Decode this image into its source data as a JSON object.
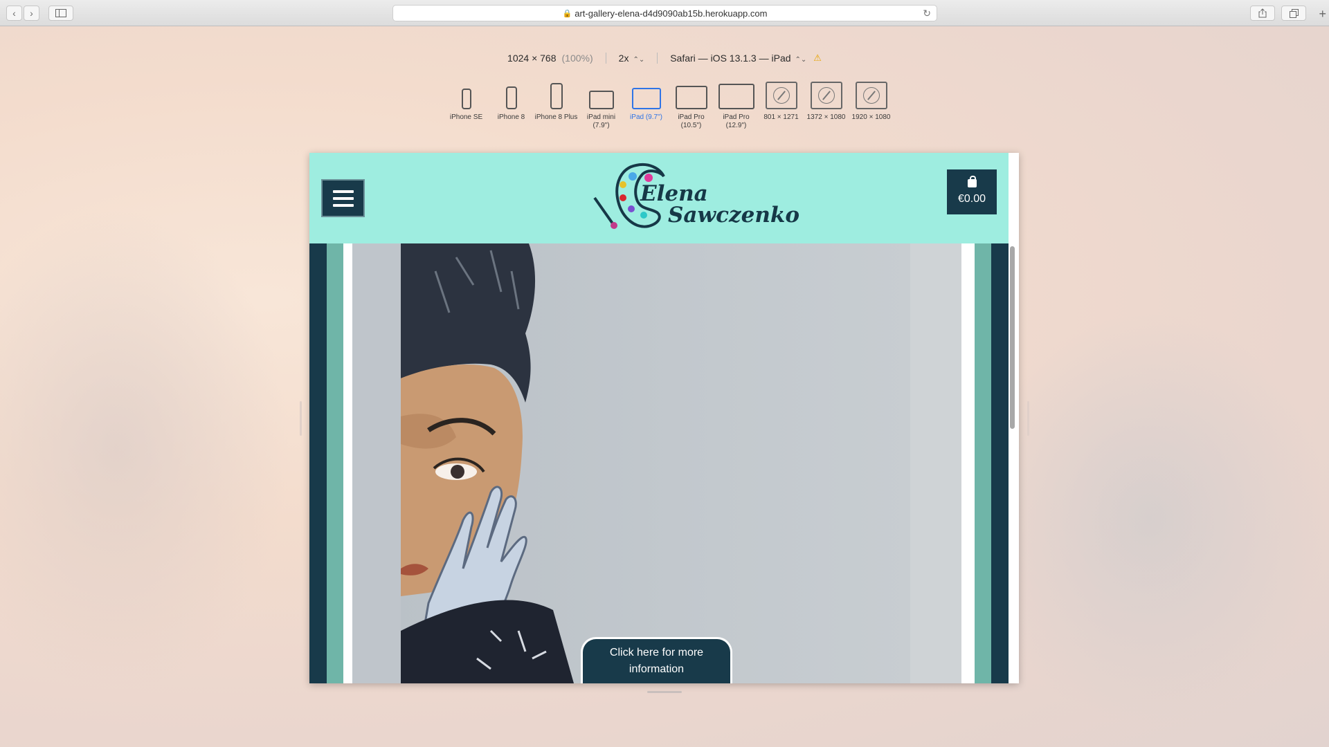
{
  "browser": {
    "url": "art-gallery-elena-d4d9090ab15b.herokuapp.com",
    "back_icon": "‹",
    "forward_icon": "›",
    "reload_icon": "↻",
    "plus_icon": "+"
  },
  "responsive_bar": {
    "size": "1024 × 768",
    "zoom_percent": "(100%)",
    "pixel_ratio": "2x",
    "user_agent": "Safari — iOS 13.1.3 — iPad",
    "warning_icon": "⚠",
    "updown_icon": "⌃⌄"
  },
  "devices": [
    {
      "label": "iPhone SE"
    },
    {
      "label": "iPhone 8"
    },
    {
      "label": "iPhone 8 Plus"
    },
    {
      "label": "iPad mini (7.9\")"
    },
    {
      "label": "iPad (9.7\")",
      "selected": true
    },
    {
      "label": "iPad Pro (10.5\")"
    },
    {
      "label": "iPad Pro (12.9\")"
    },
    {
      "label": "801 × 1271"
    },
    {
      "label": "1372 × 1080"
    },
    {
      "label": "1920 × 1080"
    }
  ],
  "site": {
    "logo_line1": "Elena",
    "logo_line2": "Sawczenko",
    "cart_total": "€0.00",
    "info_button": "Click here for more information",
    "colors": {
      "header_bg": "#9eede0",
      "dark_teal": "#183a4a",
      "mid_teal": "#6fb5a8"
    }
  }
}
